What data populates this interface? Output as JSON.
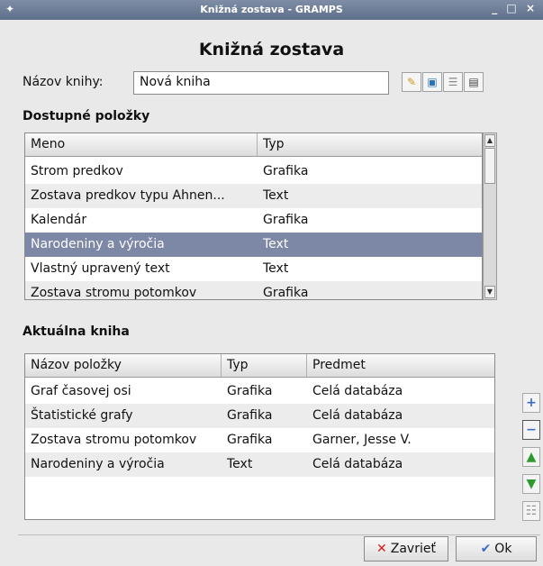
{
  "window": {
    "title": "Knižná zostava - GRAMPS",
    "app_icon": "gramps-icon",
    "controls": "_ □ ×"
  },
  "heading": "Knižná zostava",
  "book_name": {
    "label": "Názov knihy:",
    "value": "Nová kniha"
  },
  "toolbar": {
    "icons": [
      "clear-icon",
      "save-icon",
      "open-icon",
      "edit-books-icon"
    ]
  },
  "available": {
    "section_title": "Dostupné položky",
    "columns": [
      "Meno",
      "Typ"
    ],
    "rows": [
      {
        "name": "Strom predkov",
        "type": "Grafika"
      },
      {
        "name": "Zostava predkov typu Ahnen...",
        "type": "Text"
      },
      {
        "name": "Kalendár",
        "type": "Grafika"
      },
      {
        "name": "Narodeniny a výročia",
        "type": "Text",
        "selected": true
      },
      {
        "name": "Vlastný upravený text",
        "type": "Text"
      },
      {
        "name": "Zostava stromu potomkov",
        "type": "Grafika"
      }
    ]
  },
  "current_book": {
    "section_title": "Aktuálna kniha",
    "columns": [
      "Názov položky",
      "Typ",
      "Predmet"
    ],
    "rows": [
      {
        "name": "Graf časovej osi",
        "type": "Grafika",
        "subject": "Celá databáza"
      },
      {
        "name": "Štatistické grafy",
        "type": "Grafika",
        "subject": "Celá databáza"
      },
      {
        "name": "Zostava stromu potomkov",
        "type": "Grafika",
        "subject": "Garner, Jesse V."
      },
      {
        "name": "Narodeniny a výročia",
        "type": "Text",
        "subject": "Celá databáza"
      }
    ]
  },
  "side_buttons": [
    "add-icon",
    "remove-icon",
    "move-up-icon",
    "move-down-icon",
    "configure-icon"
  ],
  "buttons": {
    "close": "Zavrieť",
    "ok": "Ok"
  },
  "colors": {
    "selection": "#7d87a6",
    "titlebar": "#6b7a94",
    "close_icon": "#d21e1e",
    "ok_icon": "#3a6cc8"
  }
}
